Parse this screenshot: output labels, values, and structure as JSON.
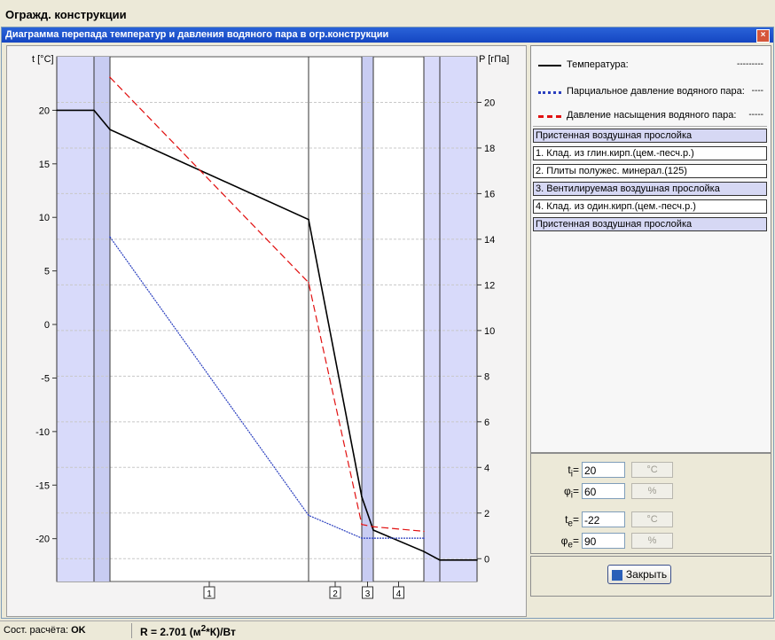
{
  "app": {
    "title": "Огражд. конструкции"
  },
  "dialog": {
    "title": "Диаграмма перепада температур и давления водяного пара в огр.конструкции",
    "close": "×"
  },
  "legend": [
    {
      "label": "Температура:",
      "value": "---------",
      "color": "#000000"
    },
    {
      "label": "Парциальное давление водяного пара:",
      "value": "----",
      "color": "#2a3fbf"
    },
    {
      "label": "Давление насыщения водяного пара:",
      "value": "-----",
      "color": "#e11010"
    }
  ],
  "layers": [
    {
      "label": "Пристенная воздушная прослойка",
      "air": true
    },
    {
      "label": "1. Клад. из глин.кирп.(цем.-песч.р.)",
      "air": false
    },
    {
      "label": "2. Плиты полужес. минерал.(125)",
      "air": false
    },
    {
      "label": "3. Вентилируемая воздушная прослойка",
      "air": true
    },
    {
      "label": "4. Клад. из один.кирп.(цем.-песч.р.)",
      "air": false
    },
    {
      "label": "Пристенная воздушная прослойка",
      "air": true
    }
  ],
  "params": {
    "ti": {
      "label": "t",
      "sub": "i",
      "value": "20",
      "unit": "°C"
    },
    "phii": {
      "label": "φ",
      "sub": "i",
      "value": "60",
      "unit": "%"
    },
    "te": {
      "label": "t",
      "sub": "e",
      "value": "-22",
      "unit": "°C"
    },
    "phie": {
      "label": "φ",
      "sub": "e",
      "value": "90",
      "unit": "%"
    }
  },
  "buttons": {
    "close": "Закрыть"
  },
  "status": {
    "calc_label": "Сост. расчёта:",
    "calc_value": "OK",
    "r_text": "R = 2.701 (м",
    "r_sup": "2",
    "r_tail": "*К)/Вт"
  },
  "chart_data": {
    "type": "line",
    "ylabel_left": "t [°C]",
    "ylabel_right": "P [гПа]",
    "ylim_left": [
      -24,
      25
    ],
    "ylim_right": [
      -1,
      22
    ],
    "left_ticks": [
      "20",
      "15",
      "10",
      "5",
      "0",
      "-5",
      "-10",
      "-15",
      "-20"
    ],
    "right_ticks": [
      "20",
      "18",
      "16",
      "14",
      "12",
      "10",
      "8",
      "6",
      "4",
      "2",
      "0"
    ],
    "layer_labels": [
      "1",
      "2",
      "3",
      "4"
    ],
    "x_bounds": [
      0,
      42,
      60,
      284,
      344,
      357,
      414,
      432,
      474
    ],
    "series": [
      {
        "name": "Температура",
        "x": [
          0,
          42,
          60,
          284,
          344,
          357,
          414,
          432,
          474
        ],
        "y": [
          20,
          20,
          18.2,
          9.8,
          -16.1,
          -19.2,
          -21.2,
          -22,
          -22
        ],
        "axis": "left",
        "color": "#000000"
      },
      {
        "name": "Парциальное давление водяного пара",
        "x": [
          60,
          284,
          344,
          357,
          414
        ],
        "y": [
          14.1,
          1.9,
          0.9,
          0.9,
          0.9
        ],
        "axis": "right",
        "color": "#2a3fbf"
      },
      {
        "name": "Давление насыщения водяного пара",
        "x": [
          60,
          284,
          344,
          357,
          414
        ],
        "y": [
          21.1,
          12.1,
          1.5,
          1.4,
          1.2
        ],
        "axis": "right",
        "color": "#e11010"
      }
    ]
  }
}
